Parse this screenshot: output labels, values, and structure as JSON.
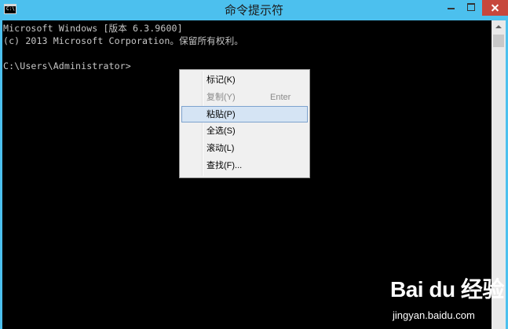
{
  "window": {
    "title": "命令提示符",
    "icon": "cmd-icon",
    "icon_text": "C:\\"
  },
  "console": {
    "lines": [
      "Microsoft Windows [版本 6.3.9600]",
      "(c) 2013 Microsoft Corporation。保留所有权利。",
      "C:\\Users\\Administrator>"
    ]
  },
  "context_menu": {
    "items": [
      {
        "label": "标记(K)",
        "shortcut": "",
        "enabled": true
      },
      {
        "label": "复制(Y)",
        "shortcut": "Enter",
        "enabled": false
      },
      {
        "label": "粘贴(P)",
        "shortcut": "",
        "enabled": true,
        "highlighted": true
      },
      {
        "label": "全选(S)",
        "shortcut": "",
        "enabled": true
      },
      {
        "label": "滚动(L)",
        "shortcut": "",
        "enabled": true
      },
      {
        "label": "查找(F)...",
        "shortcut": "",
        "enabled": true
      }
    ]
  },
  "watermark": {
    "logo": "Bai du 经验",
    "url": "jingyan.baidu.com"
  },
  "colors": {
    "titlebar": "#4cc0ee",
    "console_bg": "#000000",
    "console_text": "#c6c6c6",
    "close_button": "#c7473c",
    "menu_highlight": "#d5e4f4"
  }
}
